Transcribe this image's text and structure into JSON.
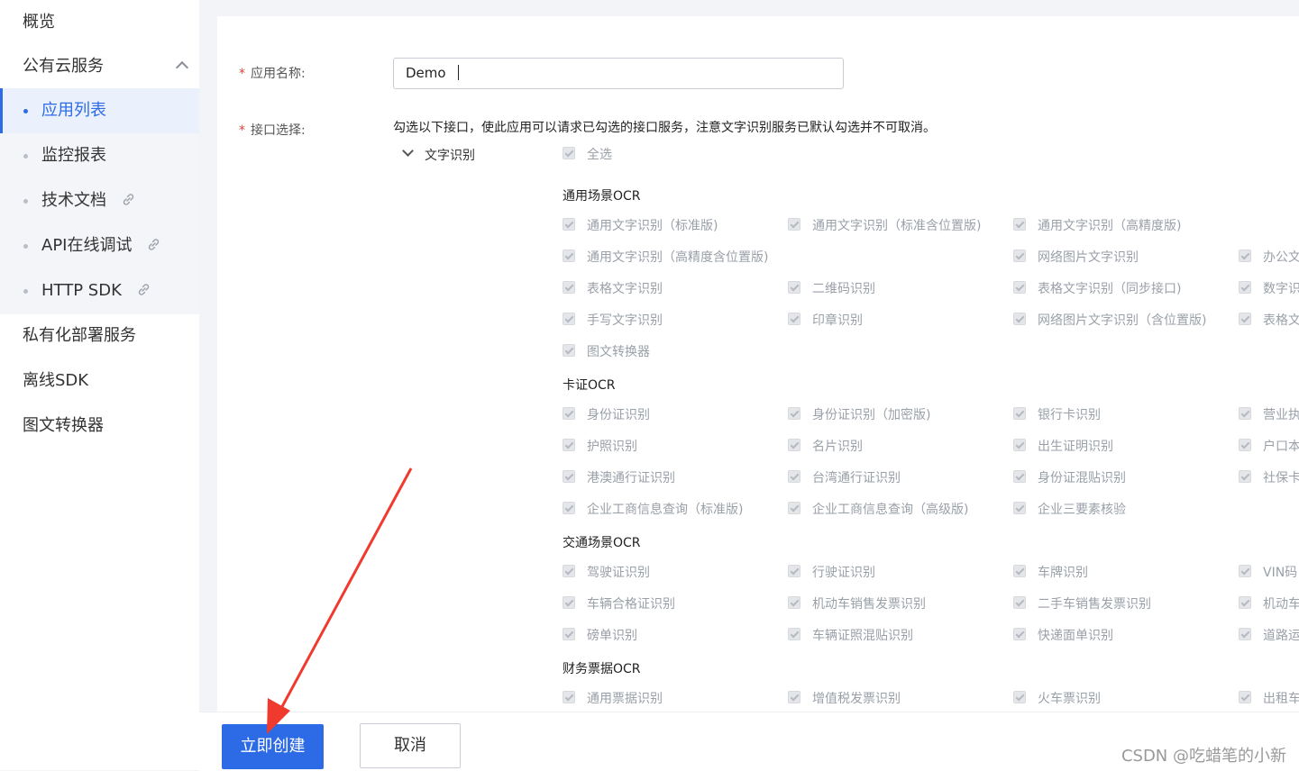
{
  "sidebar": {
    "overview": "概览",
    "public_cloud": "公有云服务",
    "sub_items": [
      "应用列表",
      "监控报表",
      "技术文档",
      "API在线调试",
      "HTTP SDK"
    ],
    "private_deploy": "私有化部署服务",
    "offline_sdk": "离线SDK",
    "converter": "图文转换器"
  },
  "form": {
    "app_name_label": "应用名称:",
    "app_name_value": "Demo",
    "api_label": "接口选择:",
    "hint": "勾选以下接口，使此应用可以请求已勾选的接口服务，注意文字识别服务已默认勾选并不可取消。",
    "category": "文字识别",
    "select_all": "全选",
    "groups": {
      "general": {
        "title": "通用场景OCR",
        "items": [
          "通用文字识别（标准版)",
          "通用文字识别（标准含位置版)",
          "通用文字识别（高精度版)",
          "通用文字识别（高精度含位置版)",
          "网络图片文字识别",
          "办公文",
          "表格文字识别",
          "二维码识别",
          "表格文字识别（同步接口)",
          "数字识",
          "手写文字识别",
          "印章识别",
          "网络图片文字识别（含位置版)",
          "表格文",
          "图文转换器"
        ]
      },
      "card": {
        "title": "卡证OCR",
        "items": [
          "身份证识别",
          "身份证识别（加密版)",
          "银行卡识别",
          "营业执",
          "护照识别",
          "名片识别",
          "出生证明识别",
          "户口本",
          "港澳通行证识别",
          "台湾通行证识别",
          "身份证混贴识别",
          "社保卡",
          "企业工商信息查询（标准版)",
          "企业工商信息查询（高级版)",
          "企业三要素核验"
        ]
      },
      "traffic": {
        "title": "交通场景OCR",
        "items": [
          "驾驶证识别",
          "行驶证识别",
          "车牌识别",
          "VIN码",
          "车辆合格证识别",
          "机动车销售发票识别",
          "二手车销售发票识别",
          "机动车",
          "磅单识别",
          "车辆证照混贴识别",
          "快递面单识别",
          "道路运"
        ]
      },
      "finance": {
        "title": "财务票据OCR",
        "items": [
          "通用票据识别",
          "增值税发票识别",
          "火车票识别",
          "出租车"
        ]
      }
    }
  },
  "footer": {
    "create_label": "立即创建",
    "cancel_label": "取消",
    "watermark": "CSDN @吃蜡笔的小新"
  },
  "colors": {
    "accent": "#2d6be6",
    "arrow": "#f03a2e"
  }
}
